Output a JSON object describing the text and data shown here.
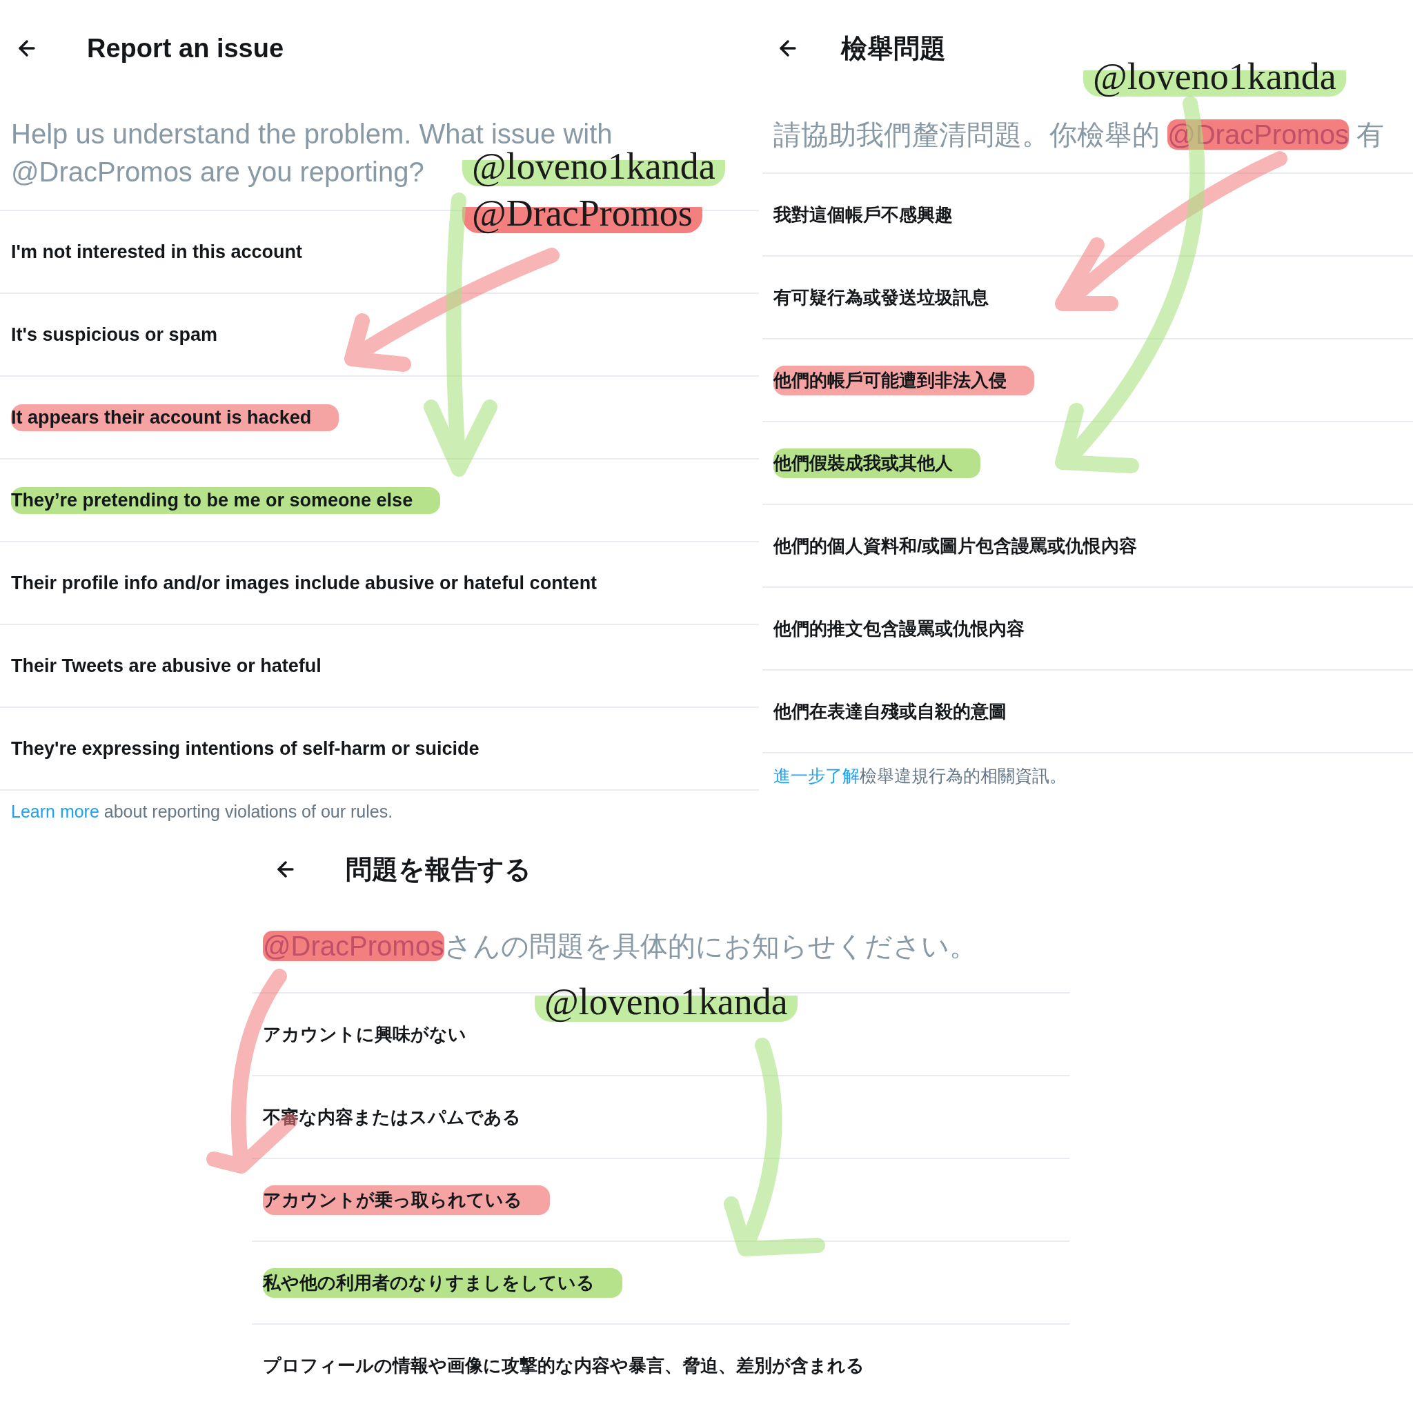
{
  "panels": [
    {
      "title": "Report an issue",
      "prompt": [
        [
          {
            "text": "Help us understand the problem. What issue with",
            "highlighted": false
          }
        ],
        [
          {
            "text": "@DracPromos are you reporting?",
            "highlighted": false
          }
        ]
      ],
      "options": [
        {
          "label": "I'm not interested in this account",
          "highlighted": false
        },
        {
          "label": "It's suspicious or spam",
          "highlighted": false
        },
        {
          "label": "It appears their account is hacked",
          "highlighted": true,
          "color": "#f5a3a3"
        },
        {
          "label": "They’re pretending to be me or someone else",
          "highlighted": true,
          "color": "#b5e28a"
        },
        {
          "label": "Their profile info and/or images include abusive or hateful content",
          "highlighted": false
        },
        {
          "label": "Their Tweets are abusive or hateful",
          "highlighted": false
        },
        {
          "label": "They're expressing intentions of self-harm or suicide",
          "highlighted": false
        }
      ],
      "footer": {
        "link": "Learn more",
        "text": " about reporting violations of our rules."
      },
      "tags": [
        {
          "text": "@loveno1kanda",
          "color": "#c3eca3"
        },
        {
          "text": "@DracPromos",
          "color": "#f47f7f"
        }
      ]
    },
    {
      "title": "檢舉問題",
      "prompt": [
        [
          {
            "text": "請協助我們釐清問題。你檢舉的 ",
            "highlighted": false
          },
          {
            "text": "@DracPromos",
            "highlighted": true,
            "color": "#f47f7f"
          },
          {
            "text": " 有",
            "highlighted": false
          }
        ]
      ],
      "options": [
        {
          "label": "我對這個帳戶不感興趣",
          "highlighted": false
        },
        {
          "label": "有可疑行為或發送垃圾訊息",
          "highlighted": false
        },
        {
          "label": "他們的帳戶可能遭到非法入侵",
          "highlighted": true,
          "color": "#f5a3a3"
        },
        {
          "label": "他們假裝成我或其他人",
          "highlighted": true,
          "color": "#b5e28a"
        },
        {
          "label": "他們的個人資料和/或圖片包含謾罵或仇恨內容",
          "highlighted": false
        },
        {
          "label": "他們的推文包含謾罵或仇恨內容",
          "highlighted": false
        },
        {
          "label": "他們在表達自殘或自殺的意圖",
          "highlighted": false
        }
      ],
      "footer": {
        "link": "進一步了解",
        "text": "檢舉違規行為的相關資訊。"
      },
      "tags": [
        {
          "text": "@loveno1kanda",
          "color": "#c3eca3"
        }
      ]
    },
    {
      "title": "問題を報告する",
      "prompt": [
        [
          {
            "text": "@DracPromos",
            "highlighted": true,
            "color": "#f47f7f"
          },
          {
            "text": "さんの問題を具体的にお知らせください。",
            "highlighted": false
          }
        ]
      ],
      "options": [
        {
          "label": "アカウントに興味がない",
          "highlighted": false
        },
        {
          "label": "不審な内容またはスパムである",
          "highlighted": false
        },
        {
          "label": "アカウントが乗っ取られている",
          "highlighted": true,
          "color": "#f5a3a3"
        },
        {
          "label": "私や他の利用者のなりすましをしている",
          "highlighted": true,
          "color": "#b5e28a"
        },
        {
          "label": "プロフィールの情報や画像に攻撃的な内容や暴言、脅迫、差別が含まれる",
          "highlighted": false
        }
      ],
      "tags": [
        {
          "text": "@loveno1kanda",
          "color": "#c3eca3"
        }
      ]
    }
  ]
}
